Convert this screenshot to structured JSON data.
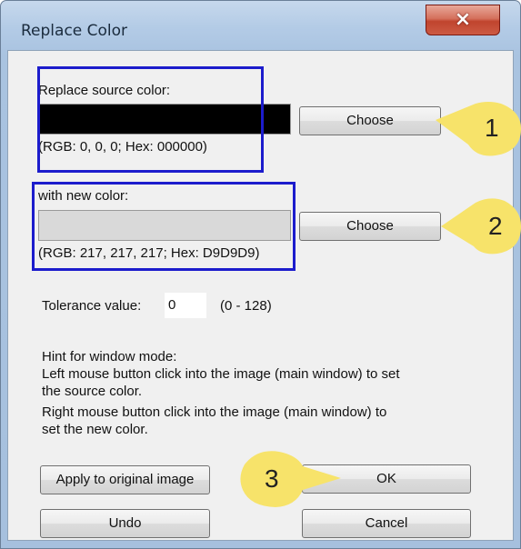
{
  "window": {
    "title": "Replace Color",
    "close_icon": "×"
  },
  "source": {
    "label": "Replace source color:",
    "swatch_color": "#000000",
    "info": "(RGB: 0, 0, 0; Hex: 000000)",
    "choose_label": "Choose"
  },
  "target": {
    "label": "with new color:",
    "swatch_color": "#D9D9D9",
    "info": "(RGB: 217, 217, 217; Hex: D9D9D9)",
    "choose_label": "Choose"
  },
  "tolerance": {
    "label": "Tolerance value:",
    "value": "0",
    "range": "(0 - 128)"
  },
  "hint": {
    "title": "Hint for window mode:",
    "line1": "Left mouse button click into the image (main window) to set",
    "line2": "the source color.",
    "line3": "Right mouse button click into the image (main window) to",
    "line4": "set the new color."
  },
  "buttons": {
    "apply": "Apply to original image",
    "ok": "OK",
    "undo": "Undo",
    "cancel": "Cancel"
  },
  "callouts": {
    "one": "1",
    "two": "2",
    "three": "3",
    "color": "#f7e36a"
  },
  "highlight_color": "#1c1ccc"
}
